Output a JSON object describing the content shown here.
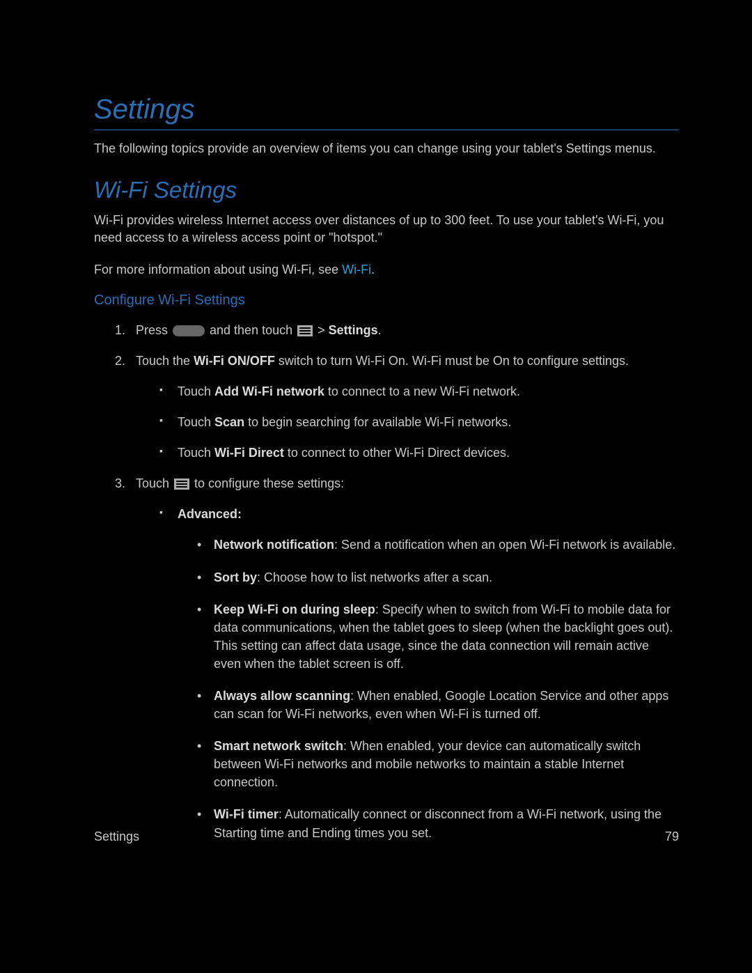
{
  "title": "Settings",
  "intro": "The following topics provide an overview of items you can change using your tablet's Settings menus.",
  "wifi": {
    "heading": "Wi-Fi Settings",
    "para1": "Wi-Fi provides wireless Internet access over distances of up to 300 feet. To use your tablet's Wi-Fi, you need access to a wireless access point or \"hotspot.\"",
    "para2_pre": "For more information about using Wi-Fi, see ",
    "para2_link": "Wi-Fi",
    "para2_post": ".",
    "configure_heading": "Configure Wi-Fi Settings",
    "step1": {
      "pre": "Press ",
      "mid": " and then touch ",
      "gt": " > ",
      "settings": "Settings",
      "post": "."
    },
    "step2": {
      "pre": "Touch the ",
      "bold": "Wi-Fi ON/OFF",
      "post": " switch to turn Wi-Fi On. Wi-Fi must be On to configure settings."
    },
    "step2_sub": {
      "a_pre": "Touch ",
      "a_bold": "Add Wi-Fi network",
      "a_post": " to connect to a new Wi-Fi network.",
      "b_pre": "Touch ",
      "b_bold": "Scan",
      "b_post": " to begin searching for available Wi-Fi networks.",
      "c_pre": "Touch ",
      "c_bold": "Wi-Fi Direct",
      "c_post": " to connect to other Wi-Fi Direct devices."
    },
    "step3": {
      "pre": "Touch ",
      "post": " to configure these settings:"
    },
    "advanced_label": "Advanced:",
    "advanced": {
      "a_bold": "Network notification",
      "a_post": ": Send a notification when an open Wi-Fi network is available.",
      "b_bold": "Sort by",
      "b_post": ": Choose how to list networks after a scan.",
      "c_bold": "Keep Wi-Fi on during sleep",
      "c_post": ": Specify when to switch from Wi-Fi to mobile data for data communications, when the tablet goes to sleep (when the backlight goes out). This setting can affect data usage, since the data connection will remain active even when the tablet screen is off.",
      "d_bold": "Always allow scanning",
      "d_post": ": When enabled, Google Location Service and other apps can scan for Wi-Fi networks, even when Wi-Fi is turned off.",
      "e_bold": "Smart network switch",
      "e_post": ": When enabled, your device can automatically switch between Wi-Fi networks and mobile networks to maintain a stable Internet connection.",
      "f_bold": "Wi-Fi timer",
      "f_post": ": Automatically connect or disconnect from a Wi-Fi network, using the Starting time and Ending times you set."
    }
  },
  "footer": {
    "section": "Settings",
    "page": "79"
  }
}
